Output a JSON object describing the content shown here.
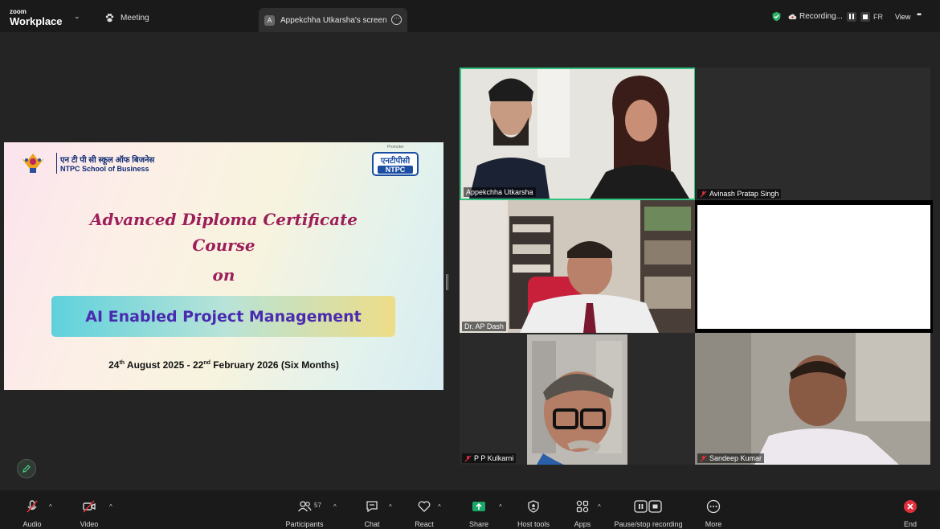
{
  "app": {
    "brand_top": "zoom",
    "brand_bottom": "Workplace"
  },
  "topbar": {
    "meeting_label": "Meeting",
    "share_tab": {
      "avatar_letter": "A",
      "label": "Appekchha Utkarsha's screen"
    },
    "recording_label": "Recording...",
    "language": "FR",
    "view_label": "View"
  },
  "slide": {
    "hindi_name": "एन टी पी सी स्कूल ऑफ बिजनेस",
    "school_name": "NTPC School of Business",
    "promoter": "Promoter",
    "ntpc_hindi": "एनटीपीसी",
    "ntpc_english": "NTPC",
    "title_line1": "Advanced Diploma Certificate",
    "title_line2": "Course",
    "title_on": "on",
    "banner": "AI Enabled Project Management",
    "date_start_day": "24",
    "date_start_sup": "th",
    "date_start_rest": " August 2025 - 22",
    "date_end_sup": "nd",
    "date_end_rest": " February 2026 (Six Months)"
  },
  "participants_grid": [
    {
      "name": "Appekchha Utkarsha",
      "muted": false,
      "active_speaker": true
    },
    {
      "name": "Avinash Pratap Singh",
      "muted": true
    },
    {
      "name": "Dr. AP Dash",
      "muted": false
    },
    {
      "name": "",
      "muted": false
    },
    {
      "name": "P P Kulkarni",
      "muted": true
    },
    {
      "name": "Sandeep Kumar",
      "muted": true
    }
  ],
  "toolbar": {
    "audio": "Audio",
    "video": "Video",
    "participants": "Participants",
    "participants_count": "57",
    "chat": "Chat",
    "react": "React",
    "share": "Share",
    "host_tools": "Host tools",
    "apps": "Apps",
    "recording": "Pause/stop recording",
    "more": "More",
    "end": "End"
  },
  "colors": {
    "active_speaker_border": "#30c37f",
    "share_green": "#1aa868",
    "end_red": "#e0303c",
    "muted_red": "#e0303c"
  }
}
